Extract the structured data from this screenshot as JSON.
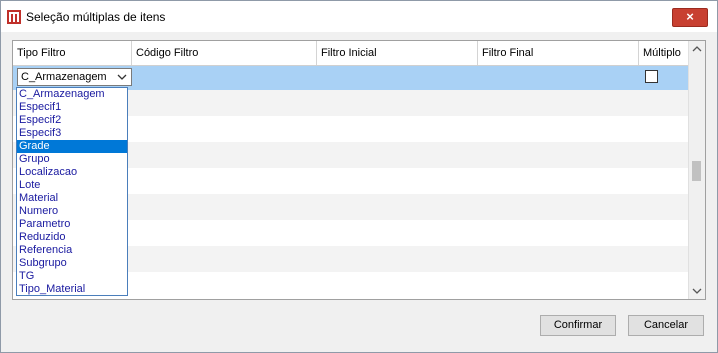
{
  "window": {
    "title": "Seleção múltiplas de itens",
    "close_symbol": "×"
  },
  "table": {
    "headers": [
      "Tipo Filtro",
      "Código Filtro",
      "Filtro Inicial",
      "Filtro Final",
      "Múltiplo"
    ],
    "row": {
      "tipo_filtro": "C_Armazenagem",
      "multiplo_checked": false
    }
  },
  "dropdown": {
    "options": [
      "C_Armazenagem",
      "Especif1",
      "Especif2",
      "Especif3",
      "Grade",
      "Grupo",
      "Localizacao",
      "Lote",
      "Material",
      "Numero",
      "Parametro",
      "Reduzido",
      "Referencia",
      "Subgrupo",
      "TG",
      "Tipo_Material"
    ],
    "highlighted": "Grade"
  },
  "buttons": {
    "confirm": "Confirmar",
    "cancel": "Cancelar"
  },
  "colors": {
    "selection": "#a9d1f5",
    "highlight": "#0078d7",
    "close": "#c84031"
  }
}
